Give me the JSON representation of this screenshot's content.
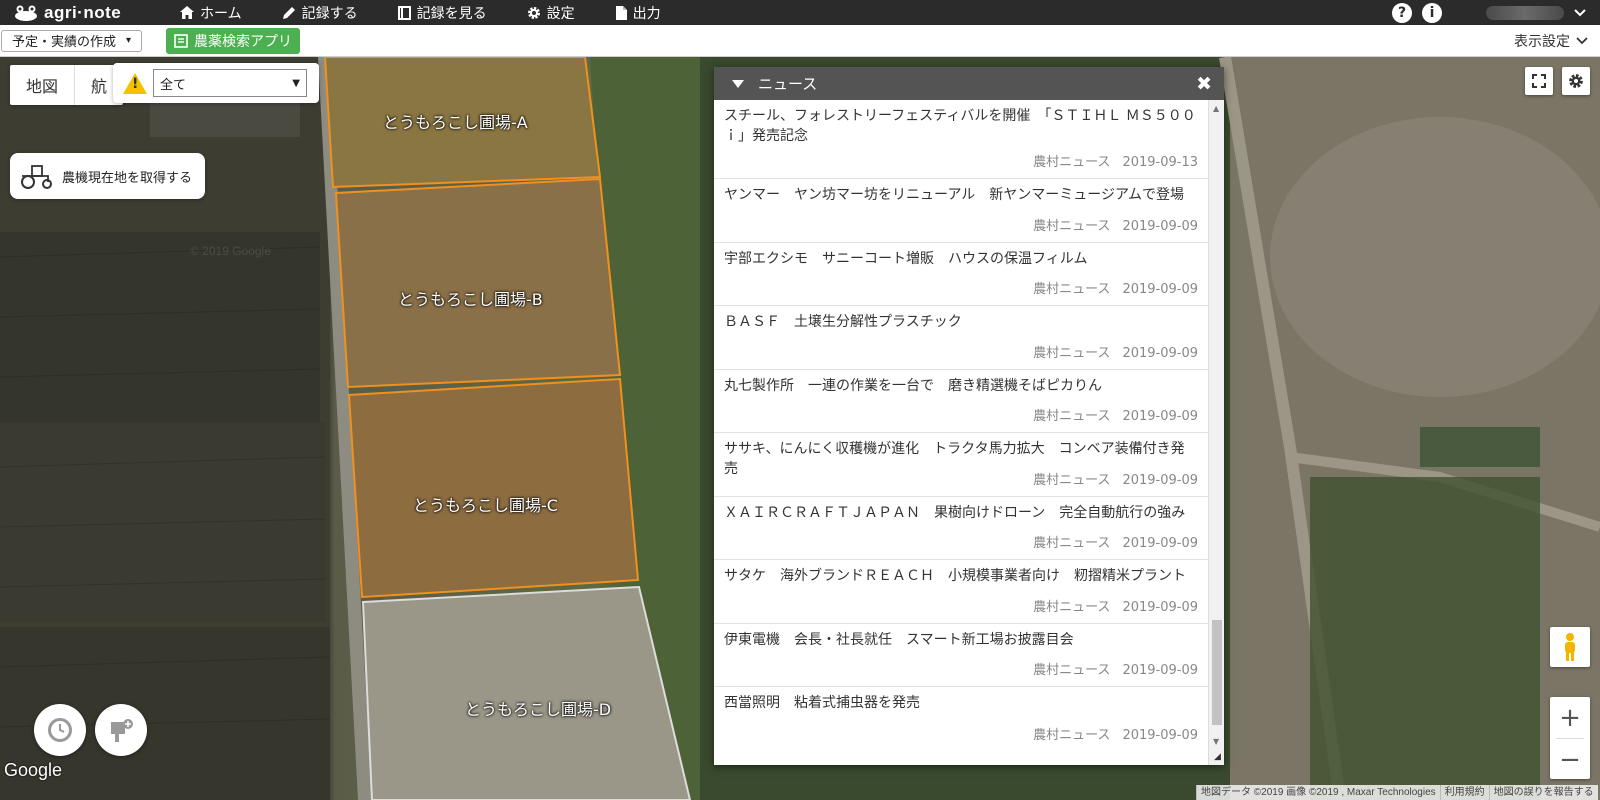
{
  "nav": {
    "logo": "agri·note",
    "items": [
      {
        "label": "ホーム",
        "icon": "home-icon"
      },
      {
        "label": "記録する",
        "icon": "pencil-icon"
      },
      {
        "label": "記録を見る",
        "icon": "book-icon"
      },
      {
        "label": "設定",
        "icon": "gear-icon"
      },
      {
        "label": "出力",
        "icon": "file-icon"
      }
    ],
    "help": "?",
    "info": "i"
  },
  "toolbar": {
    "plan_label": "予定・実績の作成",
    "app_label": "農薬検索アプリ",
    "view_setting": "表示設定"
  },
  "map": {
    "type_buttons": [
      "地図",
      "航"
    ],
    "filter_value": "全て",
    "tractor_label": "農機現在地を取得する",
    "watermark": "© 2019 Google",
    "fields": [
      "とうもろこし圃場-A",
      "とうもろこし圃場-B",
      "とうもろこし圃場-C",
      "とうもろこし圃場-D"
    ],
    "google": "Google",
    "attribution": [
      "地図データ ©2019 画像 ©2019 , Maxar Technologies",
      "利用規約",
      "地図の誤りを報告する"
    ],
    "zoom_in": "+",
    "zoom_out": "−"
  },
  "news": {
    "title": "ニュース",
    "close": "✖",
    "items": [
      {
        "title": "スチール、フォレストリーフェスティバルを開催　「ＳＴＩＨＬ ＭＳ５００ｉ」発売記念",
        "source": "農村ニュース",
        "date": "2019-09-13"
      },
      {
        "title": "ヤンマー　ヤン坊マー坊をリニューアル　新ヤンマーミュージアムで登場",
        "source": "農村ニュース",
        "date": "2019-09-09"
      },
      {
        "title": "宇部エクシモ　サニーコート増販　ハウスの保温フィルム",
        "source": "農村ニュース",
        "date": "2019-09-09"
      },
      {
        "title": "ＢＡＳＦ　土壌生分解性プラスチック",
        "source": "農村ニュース",
        "date": "2019-09-09"
      },
      {
        "title": "丸七製作所　一連の作業を一台で　磨き精選機そばピカりん",
        "source": "農村ニュース",
        "date": "2019-09-09"
      },
      {
        "title": "ササキ、にんにく収穫機が進化　トラクタ馬力拡大　コンベア装備付き発売",
        "source": "農村ニュース",
        "date": "2019-09-09"
      },
      {
        "title": "ＸＡＩＲＣＲＡＦＴＪＡＰＡＮ　果樹向けドローン　完全自動航行の強み",
        "source": "農村ニュース",
        "date": "2019-09-09"
      },
      {
        "title": "サタケ　海外ブランドＲＥＡＣＨ　小規模事業者向け　籾摺精米プラント",
        "source": "農村ニュース",
        "date": "2019-09-09"
      },
      {
        "title": "伊東電機　会長・社長就任　スマート新工場お披露目会",
        "source": "農村ニュース",
        "date": "2019-09-09"
      },
      {
        "title": "西當照明　粘着式捕虫器を発売",
        "source": "農村ニュース",
        "date": "2019-09-09"
      }
    ]
  },
  "colors": {
    "nav_bg": "#2b2b2b",
    "accent_green": "#4caf50",
    "field_orange": "#f0901e",
    "news_header": "#545454"
  }
}
